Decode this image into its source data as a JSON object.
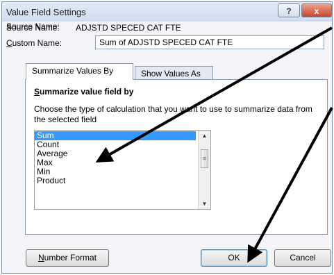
{
  "window": {
    "title": "Value Field Settings",
    "help_label": "?",
    "close_label": "x"
  },
  "source": {
    "label": "Source Name:",
    "value": "ADJSTD SPECED CAT FTE"
  },
  "custom": {
    "label_first": "C",
    "label_rest": "ustom Name:",
    "value": "Sum of ADJSTD SPECED CAT FTE"
  },
  "tabs": [
    {
      "label": "Summarize Values By",
      "active": true
    },
    {
      "label": "Show Values As",
      "active": false
    }
  ],
  "summarize": {
    "heading_first": "S",
    "heading_rest": "ummarize value field by",
    "description": "Choose the type of calculation that you want to use to summarize data from the selected field",
    "options": [
      "Sum",
      "Count",
      "Average",
      "Max",
      "Min",
      "Product"
    ],
    "selected": "Sum"
  },
  "buttons": {
    "number_format_first": "N",
    "number_format_rest": "umber Format",
    "ok": "OK",
    "cancel": "Cancel"
  },
  "colors": {
    "selection": "#3399ff",
    "annotation_arrow": "#000000",
    "close_button": "#c6452d"
  }
}
